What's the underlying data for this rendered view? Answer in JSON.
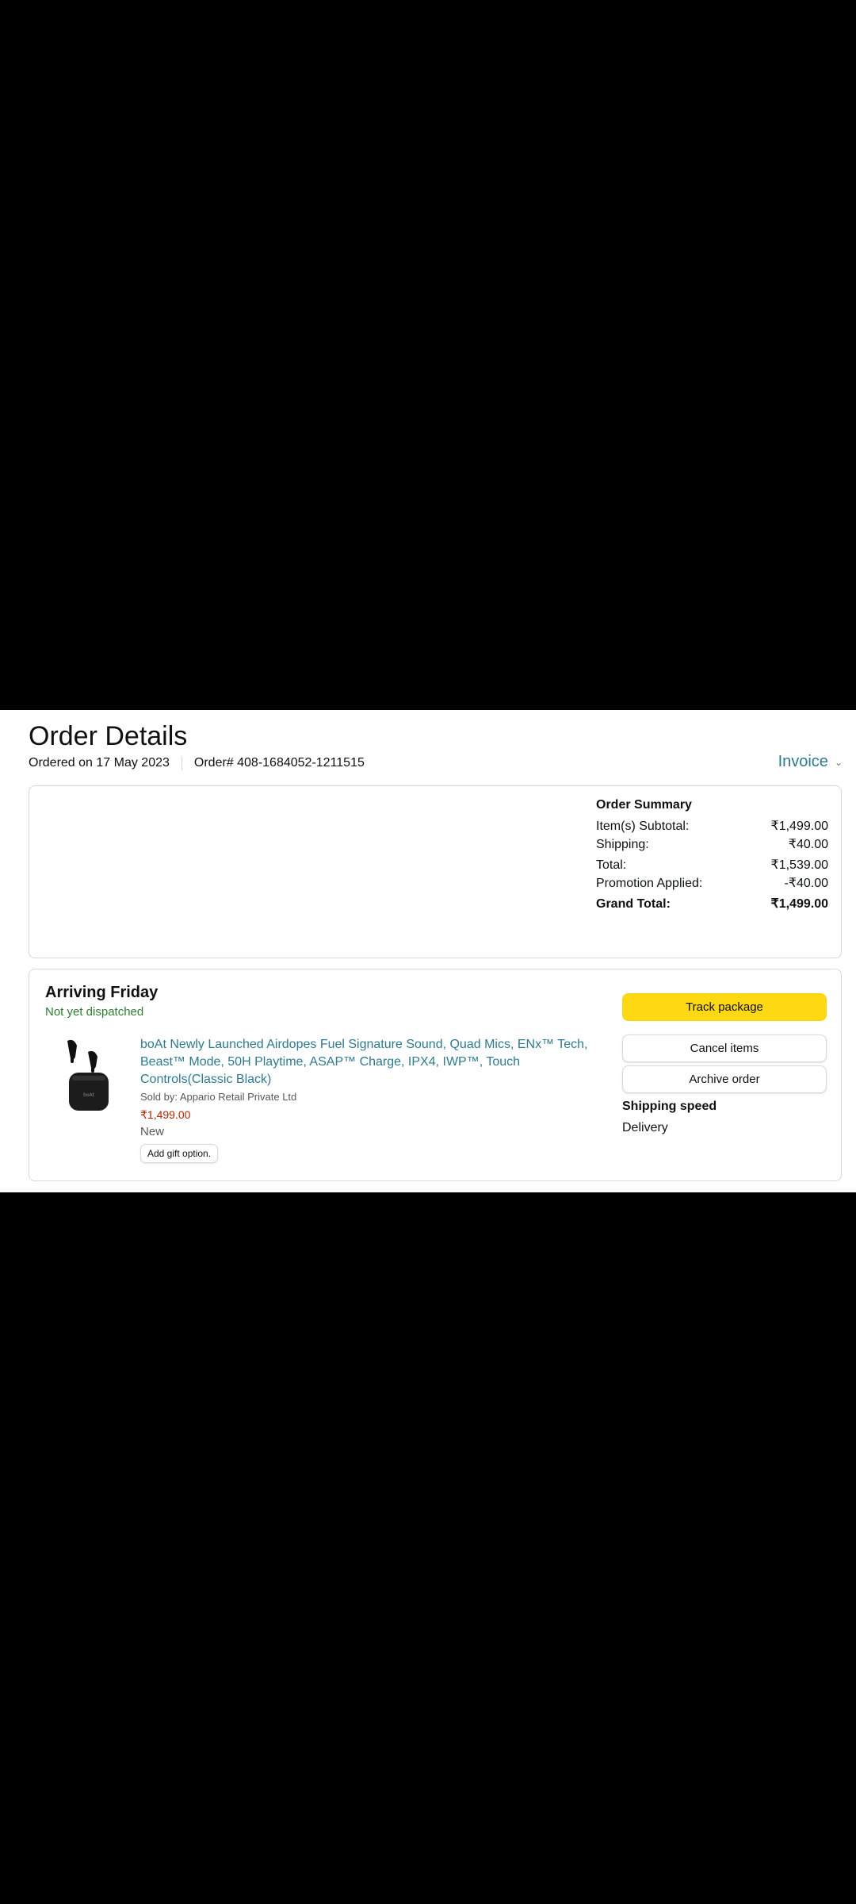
{
  "page": {
    "title": "Order Details",
    "ordered_on": "Ordered on 17 May 2023",
    "order_number": "Order# 408-1684052-1211515",
    "invoice_label": "Invoice"
  },
  "order_summary": {
    "heading": "Order Summary",
    "rows": [
      {
        "label": "Item(s) Subtotal:",
        "value": "₹1,499.00"
      },
      {
        "label": "Shipping:",
        "value": "₹40.00"
      },
      {
        "label": "Total:",
        "value": "₹1,539.00"
      },
      {
        "label": "Promotion Applied:",
        "value": "-₹40.00"
      },
      {
        "label": "Grand Total:",
        "value": "₹1,499.00"
      }
    ]
  },
  "shipment": {
    "arrival": "Arriving Friday",
    "status": "Not yet dispatched",
    "status_color": "#2f7d31",
    "product": {
      "title": "boAt Newly Launched Airdopes Fuel Signature Sound, Quad Mics, ENx™ Tech, Beast™ Mode, 50H Playtime, ASAP™ Charge, IPX4, IWP™, Touch Controls(Classic Black)",
      "sold_by": "Sold by: Appario Retail Private Ltd",
      "price": "₹1,499.00",
      "condition": "New",
      "gift_option_label": "Add gift option."
    },
    "actions": {
      "track_label": "Track package",
      "cancel_label": "Cancel items",
      "archive_label": "Archive order"
    },
    "shipping_speed_label": "Shipping speed",
    "shipping_speed_value": "Delivery"
  },
  "colors": {
    "link": "#2f7a8e",
    "primary_button": "#ffd814",
    "price": "#b12704"
  },
  "icons": {
    "invoice_dropdown": "chevron-down-icon",
    "product_image": "earbuds-product-image"
  }
}
